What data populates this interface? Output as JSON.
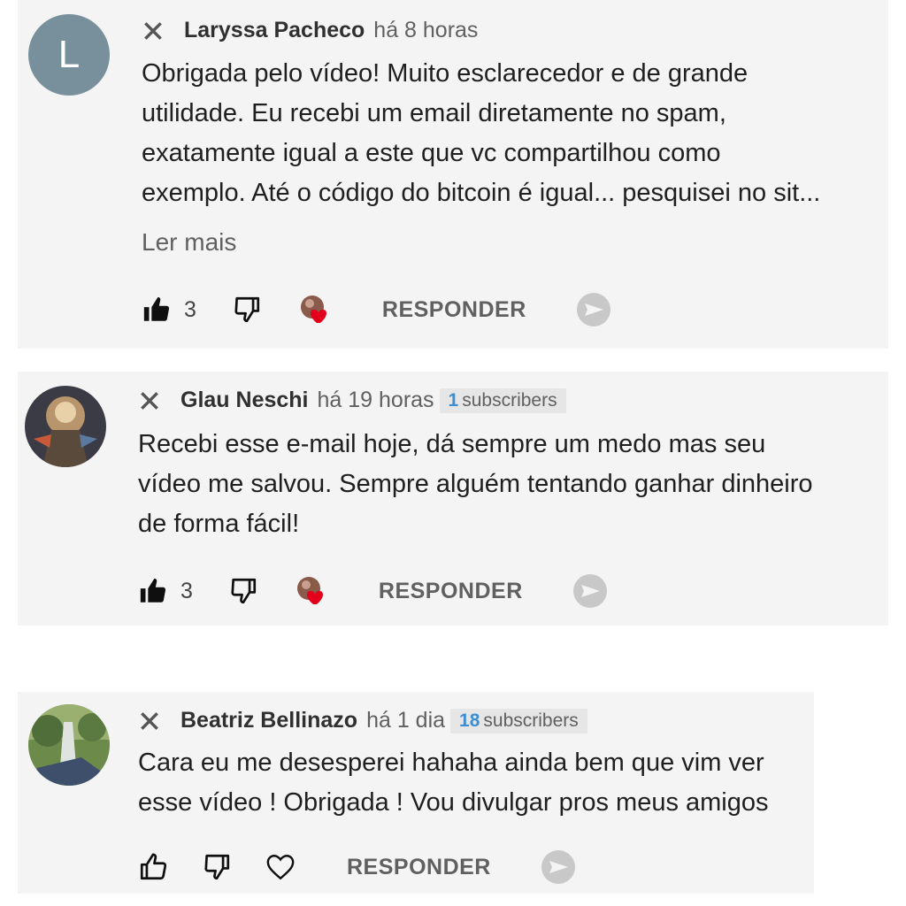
{
  "comments": [
    {
      "author": "Laryssa Pacheco",
      "time": "há 8 horas",
      "avatar_letter": "L",
      "text_lines": [
        "Obrigada pelo vídeo! Muito esclarecedor e de grande",
        "utilidade.  Eu recebi um email  diretamente no spam,",
        "exatamente igual a este que vc compartilhou como",
        "exemplo. Até o código do bitcoin é igual... pesquisei no sit..."
      ],
      "read_more": "Ler mais",
      "likes": "3",
      "reply_label": "RESPONDER"
    },
    {
      "author": "Glau Neschi",
      "time": "há 19 horas",
      "subscribers_count": "1",
      "subscribers_label": "subscribers",
      "text_lines": [
        "Recebi esse e-mail hoje, dá sempre um medo mas seu",
        "vídeo me salvou. Sempre alguém tentando ganhar dinheiro",
        "de forma fácil!"
      ],
      "likes": "3",
      "reply_label": "RESPONDER"
    },
    {
      "author": "Beatriz Bellinazo",
      "time": "há 1 dia",
      "subscribers_count": "18",
      "subscribers_label": "subscribers",
      "text_lines": [
        "Cara eu me desesperei hahaha ainda bem que vim ver",
        "esse vídeo ! Obrigada ! Vou divulgar pros meus amigos"
      ],
      "reply_label": "RESPONDER"
    }
  ]
}
